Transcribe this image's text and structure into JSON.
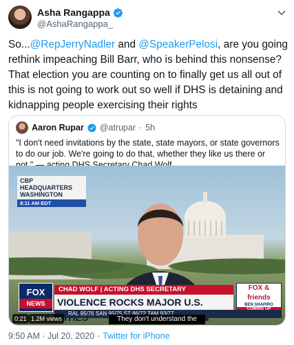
{
  "author": {
    "name": "Asha Rangappa",
    "handle": "@AshaRangappa_"
  },
  "tweet": {
    "prefix": "So...",
    "mention1": "@RepJerryNadler",
    "mid1": " and ",
    "mention2": "@SpeakerPelosi",
    "rest": ", are you going rethink impeaching Bill Barr, who is behind this nonsense? That election you are counting on to finally get us all out of this is not going to work out so well if DHS is detaining and kidnapping people exercising their rights"
  },
  "quote": {
    "name": "Aaron Rupar",
    "handle": "@atrupar",
    "dot": "·",
    "time": "5h",
    "text": "\"I don't need invitations by the state, state mayors, or state governors to do our job. We're going to do that, whether they like us there or not.\" — acting DHS Secretary Chad Wolf"
  },
  "video": {
    "location_title": "CBP HEADQUARTERS WASHINGTON",
    "location_time": "8:11 AM EDT",
    "network_logo": "FOX",
    "network_sub": "NEWS",
    "nameplate": "CHAD WOLF | ACTING DHS SECRETARY",
    "headline": "VIOLENCE ROCKS MAJOR U.S. CITIES",
    "promo_logo": "FOX & friends",
    "promo_guest": "BEN SHAPIRO",
    "promo_cta": "COMING UP",
    "ticker": "RAL 95/76   SAN 95/75   ST 86/72   TAM 93/77",
    "caption": "They don't understand the",
    "elapsed": "0:21",
    "views": "1.2M views"
  },
  "footer": {
    "time": "9:50 AM · Jul 20, 2020",
    "sep": "·",
    "app": "Twitter for iPhone"
  },
  "colors": {
    "link": "#1d9bf0",
    "muted": "#536471",
    "fox_red": "#c8102e",
    "fox_navy": "#0d2a6b"
  }
}
